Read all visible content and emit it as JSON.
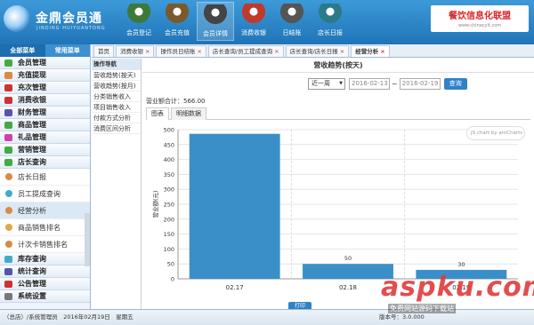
{
  "header": {
    "brand": "金鼎会员通",
    "brand_sub": "JINDING HUIYUANTONG",
    "toolbar": [
      {
        "label": "会员登记",
        "icon": "member-register-icon",
        "color": "#3b7a3b"
      },
      {
        "label": "会员充值",
        "icon": "member-recharge-icon",
        "color": "#7a5a2a"
      },
      {
        "label": "会员详情",
        "icon": "member-detail-icon",
        "color": "#444"
      },
      {
        "label": "消费收银",
        "icon": "cash-register-icon",
        "color": "#c0392b"
      },
      {
        "label": "日结账",
        "icon": "daily-settlement-icon",
        "color": "#555"
      },
      {
        "label": "店长日报",
        "icon": "manager-report-icon",
        "color": "#2a7a8a"
      }
    ],
    "partner": {
      "title": "餐饮信息化联盟",
      "url": "www.chinacyit.com"
    }
  },
  "sidebar": {
    "tabs": [
      "全部菜单",
      "常用菜单"
    ],
    "top_items": [
      {
        "label": "会员管理",
        "color": "#4a4"
      },
      {
        "label": "充值提现",
        "color": "#d84"
      },
      {
        "label": "充次管理",
        "color": "#c33"
      },
      {
        "label": "消费收银",
        "color": "#c33"
      },
      {
        "label": "财务管理",
        "color": "#55a"
      },
      {
        "label": "商品管理",
        "color": "#4a4"
      },
      {
        "label": "礼品管理",
        "color": "#c4a"
      },
      {
        "label": "营销管理",
        "color": "#4a4"
      },
      {
        "label": "店长查询",
        "color": "#4a4"
      }
    ],
    "sub_items": [
      {
        "label": "店长日报",
        "color": "#d84"
      },
      {
        "label": "员工提成查询",
        "color": "#4ac"
      },
      {
        "label": "经营分析",
        "color": "#d84",
        "selected": true
      },
      {
        "label": "商品销售排名",
        "color": "#da4"
      },
      {
        "label": "计次卡销售排名",
        "color": "#d84"
      }
    ],
    "bottom_items": [
      {
        "label": "库存查询",
        "color": "#4ac"
      },
      {
        "label": "统计查询",
        "color": "#55a"
      },
      {
        "label": "公告管理",
        "color": "#c33"
      },
      {
        "label": "系统设置",
        "color": "#777"
      }
    ]
  },
  "tabs": [
    {
      "label": "首页",
      "close": ""
    },
    {
      "label": "消费收银",
      "close": "×"
    },
    {
      "label": "操作员日结账",
      "close": "×"
    },
    {
      "label": "店长查询/员工提成查询",
      "close": "×"
    },
    {
      "label": "店长查询/店长日报",
      "close": "×"
    },
    {
      "label": "经营分析",
      "close": "×",
      "active": true
    }
  ],
  "subnav": {
    "header": "操作导航",
    "items": [
      "营收趋势(按天)",
      "营收趋势(按月)",
      "分类销售收入",
      "项目销售收入",
      "付款方式分析",
      "消费区间分析"
    ]
  },
  "main": {
    "title": "营收趋势(按天)",
    "period": "近一周",
    "date_from": "2016-02-13",
    "date_sep": "~",
    "date_to": "2016-02-19",
    "query_label": "查询",
    "total_label": "营业额合计：",
    "total_value": "566.00",
    "chart_tabs": [
      "图表",
      "明细数据"
    ],
    "credit": "JS chart by amCharts",
    "print_label": "打印"
  },
  "chart_data": {
    "type": "bar",
    "categories": [
      "02.17",
      "02.18",
      "02.19"
    ],
    "values": [
      486,
      50,
      30
    ],
    "data_labels": [
      "",
      "50",
      "30"
    ],
    "ylabel": "营业额(元)",
    "ylim": [
      0,
      500
    ],
    "yticks": [
      0,
      50,
      100,
      150,
      200,
      250,
      300,
      350,
      400,
      450,
      500
    ],
    "bar_color": "#3a8fc9",
    "grid": true
  },
  "status": {
    "left": "（总店）/系统管理员　2016年02月19日　星期五",
    "version": "版本号：3.0.000",
    "watermark": "aspku.com",
    "watermark_sub": "免费网站源码下载站"
  }
}
